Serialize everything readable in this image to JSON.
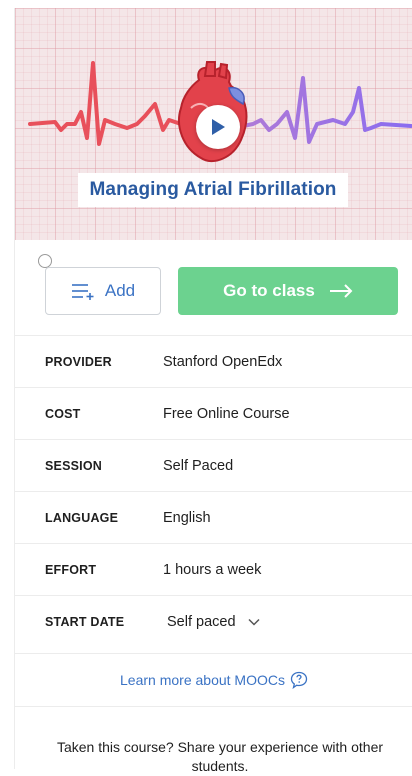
{
  "hero": {
    "title": "Managing Atrial Fibrillation"
  },
  "actions": {
    "add_label": "Add",
    "go_label": "Go to class"
  },
  "details": [
    {
      "key": "PROVIDER",
      "value": "Stanford OpenEdx"
    },
    {
      "key": "COST",
      "value": "Free Online Course"
    },
    {
      "key": "SESSION",
      "value": "Self Paced"
    },
    {
      "key": "LANGUAGE",
      "value": "English"
    },
    {
      "key": "EFFORT",
      "value": "1 hours a week"
    },
    {
      "key": "START DATE",
      "value": "Self paced"
    }
  ],
  "learn_more": "Learn more about MOOCs",
  "share_prompt": "Taken this course? Share your experience with other students.",
  "colors": {
    "accent_blue": "#3b73c4",
    "go_green": "#6cd28f",
    "hero_title_blue": "#2a5aa0"
  },
  "icons": {
    "play": "play-icon",
    "add_list": "playlist-add-icon",
    "arrow": "arrow-right-icon",
    "chevron": "chevron-down-icon",
    "help": "question-bubble-icon"
  }
}
